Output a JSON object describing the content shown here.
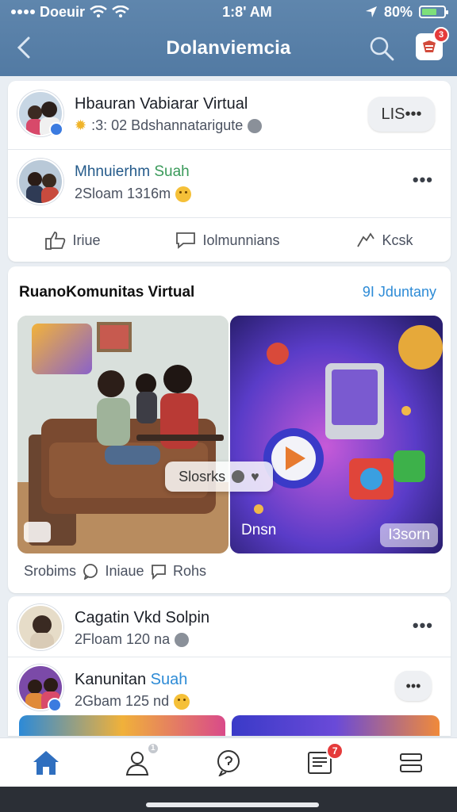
{
  "status": {
    "carrier": "Doeuir",
    "time": "1:8' AM",
    "battery": "80%"
  },
  "header": {
    "title": "Dolanviemcia",
    "notif_badge": "3"
  },
  "post1": {
    "name": "Hbauran Vabiarar Virtual",
    "meta": ":3: 02 Bdshannatarigute",
    "pill": "LIS•••"
  },
  "post2": {
    "name_first": "Mhnuierhm",
    "name_second": "Suah",
    "meta": "2Sloam  1316m"
  },
  "actions": {
    "like": "Iriue",
    "comment": "Iolmunnians",
    "share": "Kcsk"
  },
  "community": {
    "title": "RuanoKomunitas Virtual",
    "link": "9I Jduntany",
    "chip": "Slosrks",
    "media_left_label": "",
    "media_right_label": "Dnsn",
    "media_right_corner": "I3sorn"
  },
  "community_actions": {
    "a": "Srobims",
    "b": "Iniaue",
    "c": "Rohs"
  },
  "post3": {
    "name": "Cagatin Vkd Solpin",
    "meta": "2Floam 120 na"
  },
  "post4": {
    "name_first": "Kanunitan",
    "name_second": "Suah",
    "meta": "2Gbam 125 nd"
  },
  "tabbar": {
    "badge_profile": "1",
    "badge_news": "7"
  },
  "colors": {
    "header": "#5a80a8",
    "accent_blue": "#2d8bd6",
    "badge_red": "#e53b3b"
  }
}
